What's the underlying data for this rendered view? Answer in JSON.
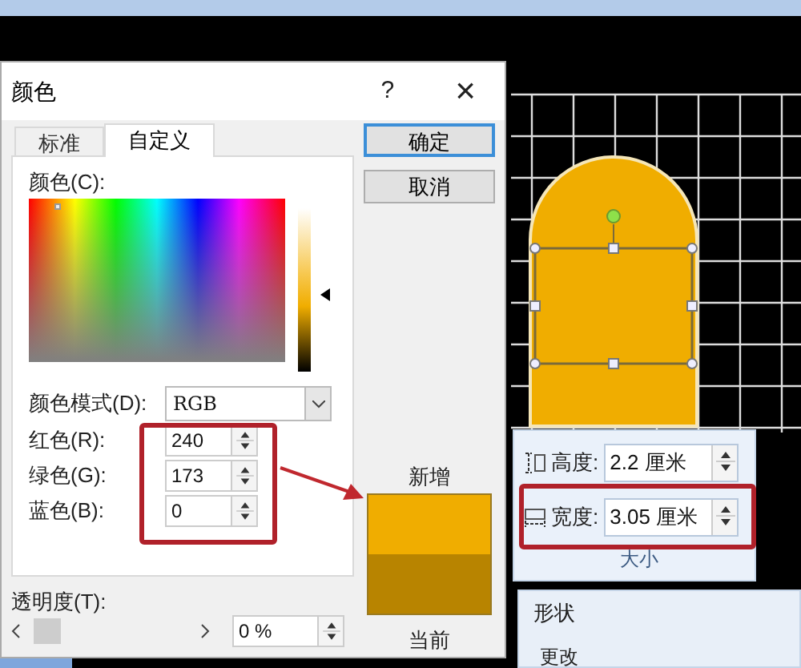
{
  "window": {
    "title": "颜色",
    "help": "?",
    "close": "×"
  },
  "tabs": [
    {
      "label": "标准",
      "selected": false
    },
    {
      "label": "自定义",
      "selected": true
    }
  ],
  "buttons": [
    {
      "label": "确定",
      "default": true
    },
    {
      "label": "取消",
      "default": false
    }
  ],
  "color_picker": {
    "label": "颜色(C):"
  },
  "color_mode": {
    "label": "颜色模式(D):",
    "value": "RGB"
  },
  "channels": [
    {
      "label": "红色(R):",
      "value": "240"
    },
    {
      "label": "绿色(G):",
      "value": "173"
    },
    {
      "label": "蓝色(B):",
      "value": "0"
    }
  ],
  "swatches": [
    {
      "label": "新增",
      "color": "#f0ad00"
    },
    {
      "label": "当前",
      "color": "#b88400"
    }
  ],
  "transparency": {
    "label": "透明度(T):",
    "level": 0,
    "value": "0 %"
  },
  "ribbon": {
    "fields": [
      {
        "kind": "height",
        "label": "高度:",
        "value": "2.2 厘米"
      },
      {
        "kind": "width",
        "label": "宽度:",
        "value": "3.05 厘米"
      }
    ],
    "group_label": "大小"
  },
  "styles_panel": {
    "title": "形状",
    "button": "更改"
  }
}
